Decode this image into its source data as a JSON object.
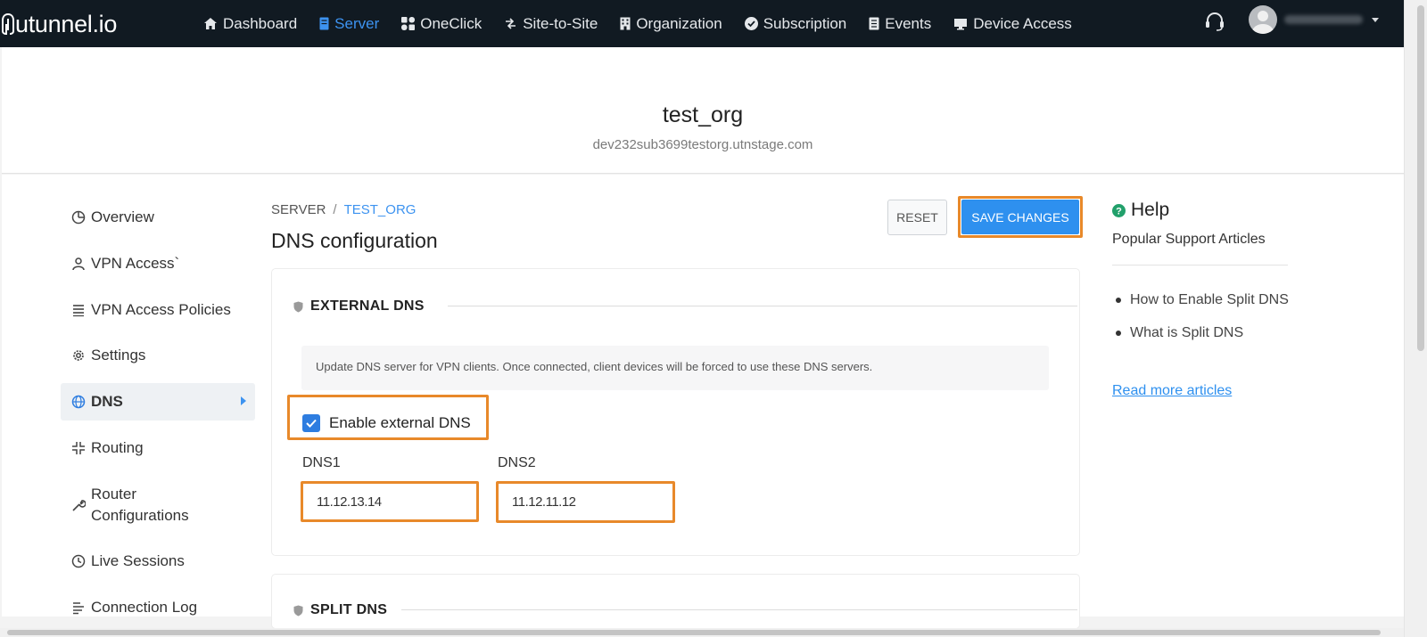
{
  "brand": {
    "logo_text": "utunnel.io",
    "accent_color": "#3d93f0",
    "highlight_color": "#e8892a"
  },
  "nav": {
    "items": [
      {
        "label": "Dashboard",
        "icon": "home-icon"
      },
      {
        "label": "Server",
        "icon": "server-icon",
        "active": true
      },
      {
        "label": "OneClick",
        "icon": "oneclick-icon"
      },
      {
        "label": "Site-to-Site",
        "icon": "site-to-site-icon"
      },
      {
        "label": "Organization",
        "icon": "building-icon"
      },
      {
        "label": "Subscription",
        "icon": "check-circle-icon"
      },
      {
        "label": "Events",
        "icon": "events-icon"
      },
      {
        "label": "Device Access",
        "icon": "monitor-icon"
      }
    ],
    "support_icon": "headset-icon"
  },
  "header": {
    "org_name": "test_org",
    "org_domain": "dev232sub3699testorg.utnstage.com"
  },
  "sidebar": {
    "items": [
      {
        "label": "Overview",
        "icon": "pie-chart-icon"
      },
      {
        "label": "VPN Access`",
        "icon": "user-icon"
      },
      {
        "label": "VPN Access Policies",
        "icon": "list-icon"
      },
      {
        "label": "Settings",
        "icon": "gear-icon"
      },
      {
        "label": "DNS",
        "icon": "globe-icon",
        "active": true
      },
      {
        "label": "Routing",
        "icon": "routing-icon"
      },
      {
        "label": "Router Configurations",
        "icon": "wrench-icon"
      },
      {
        "label": "Live Sessions",
        "icon": "clock-icon"
      },
      {
        "label": "Connection Log",
        "icon": "log-icon"
      }
    ]
  },
  "main": {
    "breadcrumb": {
      "root": "SERVER",
      "separator": "/",
      "current": "TEST_ORG"
    },
    "title": "DNS configuration",
    "reset_label": "RESET",
    "save_label": "SAVE CHANGES",
    "external_dns": {
      "heading": "EXTERNAL DNS",
      "info": "Update DNS server for VPN clients. Once connected, client devices will be forced to use these DNS servers.",
      "enable_label": "Enable external DNS",
      "enabled": true,
      "dns1_label": "DNS1",
      "dns1_value": "11.12.13.14",
      "dns2_label": "DNS2",
      "dns2_value": "11.12.11.12"
    },
    "split_dns": {
      "heading": "SPLIT DNS"
    }
  },
  "help": {
    "title": "Help",
    "subtitle": "Popular Support Articles",
    "articles": [
      "How to Enable Split DNS",
      "What is Split DNS"
    ],
    "read_more": "Read more articles"
  }
}
